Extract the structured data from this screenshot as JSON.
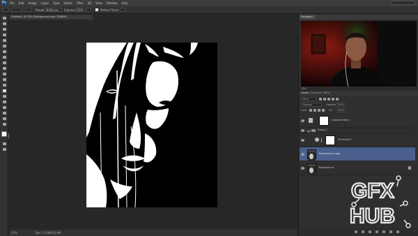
{
  "app": {
    "logo": "Ps"
  },
  "menus": [
    "File",
    "Edit",
    "Image",
    "Layer",
    "Type",
    "Select",
    "Filter",
    "3D",
    "View",
    "Window",
    "Help"
  ],
  "options_bar": {
    "range_label": "Range:",
    "range_value": "Midtones",
    "exposure_label": "Exposure:",
    "exposure_value": "50%",
    "protect_tones": "Protect Tones"
  },
  "document": {
    "tab_title": "Untitled-1 @ 33% (Background copy, RGB/8*)",
    "zoom": "33%",
    "doc_size": "Doc: 5.93M/14.0M"
  },
  "navigator": {
    "tab": "Navigator",
    "zoom": "33%"
  },
  "layers_panel": {
    "tabs": [
      "Layers",
      "Channels",
      "Paths"
    ],
    "kind": "Kind",
    "blend_mode": "Normal",
    "opacity_label": "Opacity:",
    "opacity": "100%",
    "lock_label": "Lock:",
    "fill_label": "Fill:",
    "fill": "100%",
    "layers": [
      {
        "name": "Gradient Map 1",
        "selected": false
      },
      {
        "name": "Group 1",
        "selected": false
      },
      {
        "name": "Threshold 1",
        "selected": false
      },
      {
        "name": "Background copy",
        "selected": true
      },
      {
        "name": "Background",
        "selected": false
      }
    ]
  },
  "watermark": {
    "line1": "GFX",
    "line2": "HUB"
  },
  "icons": {
    "eye": "eye-icon",
    "lock": "lock-icon",
    "folder": "folder-icon",
    "link": "link-icon",
    "adjustment": "adjustment-icon"
  },
  "colors": {
    "selection": "#4a5f8c",
    "watermark": "#e9e9e9",
    "panel_bg": "#2f2f2f",
    "canvas_bg": "#272727"
  }
}
